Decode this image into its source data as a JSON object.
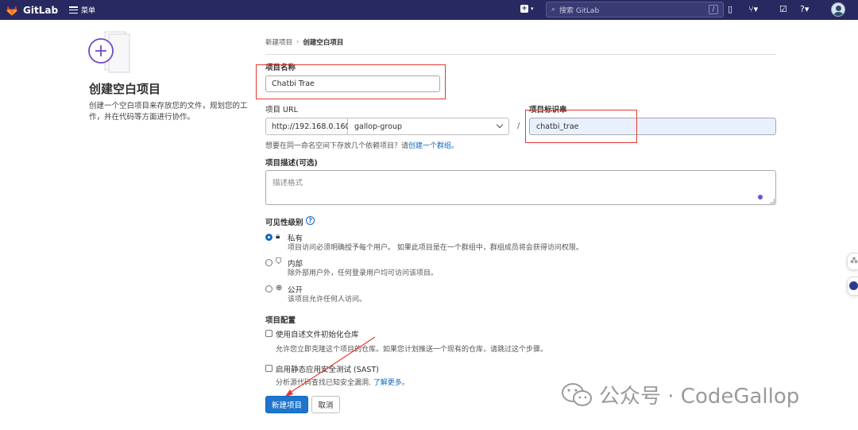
{
  "topbar": {
    "brand": "GitLab",
    "menu_label": "菜单",
    "search_placeholder": "搜索 GitLab",
    "search_shortcut": "/"
  },
  "left_panel": {
    "title": "创建空白项目",
    "description": "创建一个空白项目来存放您的文件，规划您的工作，并在代码等方面进行协作。"
  },
  "breadcrumb": {
    "parent": "新建项目",
    "separator": "›",
    "current": "创建空白项目"
  },
  "form": {
    "name_label": "项目名称",
    "name_value": "Chatbi Trae",
    "url_label": "项目 URL",
    "url_prefix": "http://192.168.0.160/",
    "url_group": "gallop-group",
    "url_separator": "/",
    "slug_label": "项目标识串",
    "slug_value": "chatbi_trae",
    "group_hint_prefix": "想要在同一命名空间下存放几个依赖项目？请",
    "group_hint_link": "创建一个群组。",
    "description_label": "项目描述(可选)",
    "description_placeholder": "描述格式",
    "visibility_label": "可见性级别",
    "visibility_help": "?",
    "visibility_options": [
      {
        "label": "私有",
        "description": "项目访问必须明确授予每个用户。 如果此项目是在一个群组中，群组成员将会获得访问权限。",
        "icon": "lock-icon",
        "checked": true
      },
      {
        "label": "内部",
        "description": "除外部用户外，任何登录用户均可访问该项目。",
        "icon": "shield-icon",
        "checked": false
      },
      {
        "label": "公开",
        "description": "该项目允许任何人访问。",
        "icon": "globe-icon",
        "checked": false
      }
    ],
    "config_label": "项目配置",
    "config_options": [
      {
        "label": "使用自述文件初始化仓库",
        "description": "允许您立即克隆这个项目的仓库。如果您计划推送一个现有的仓库，请跳过这个步骤。",
        "checked": false
      },
      {
        "label": "启用静态应用安全测试 (SAST)",
        "description_prefix": "分析源代码查找已知安全漏洞. ",
        "description_link": "了解更多。",
        "checked": false
      }
    ],
    "submit_label": "新建项目",
    "cancel_label": "取消"
  },
  "watermark": {
    "text": "公众号 · CodeGallop"
  },
  "colors": {
    "nav_bg": "#292961",
    "primary": "#1f75cb",
    "annotation_red": "#e53935",
    "link": "#1068bf"
  }
}
